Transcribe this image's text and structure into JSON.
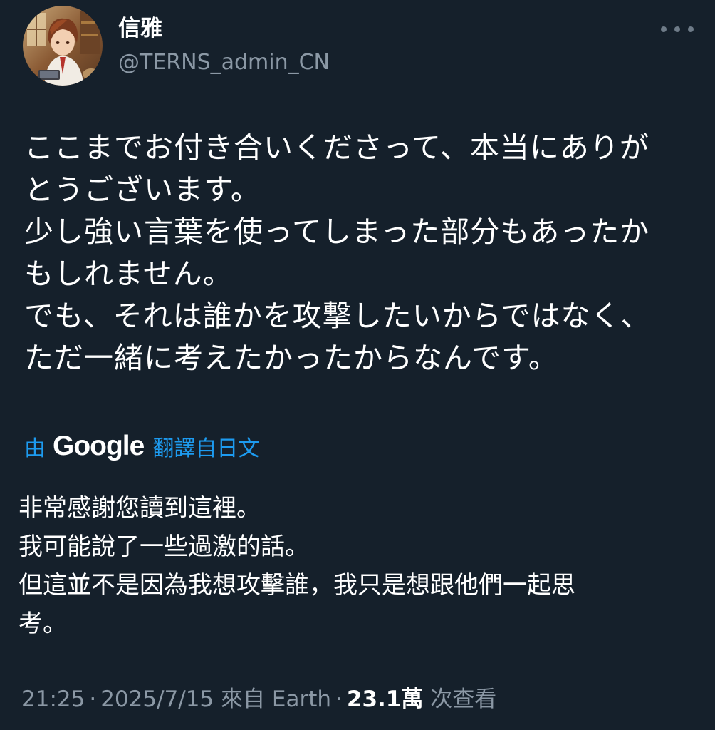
{
  "author": {
    "display_name": "信雅",
    "handle": "@TERNS_admin_CN"
  },
  "tweet": {
    "original_lines": [
      "ここまでお付き合いくださって、本当にありが",
      "とうございます。",
      "少し強い言葉を使ってしまった部分もあったか",
      "もしれません。",
      "でも、それは誰かを攻撃したいからではなく、",
      "ただ一緒に考えたかったからなんです。"
    ],
    "translation_by": "由",
    "translation_brand": "Google",
    "translation_label": "翻譯自日文",
    "translated_lines": [
      "非常感謝您讀到這裡。",
      "我可能說了一些過激的話。",
      "但這並不是因為我想攻擊誰，我只是想跟他們一起思",
      "考。"
    ]
  },
  "meta": {
    "time": "21:25",
    "separator": "·",
    "date": "2025/7/15",
    "source": "來自 Earth",
    "views_count": "23.1萬",
    "views_label": "次查看"
  },
  "icons": {
    "more": "more-horizontal-icon"
  },
  "colors": {
    "background": "#15202b",
    "text": "#ffffff",
    "secondary": "#8b98a5",
    "accent": "#1d9bf0"
  }
}
